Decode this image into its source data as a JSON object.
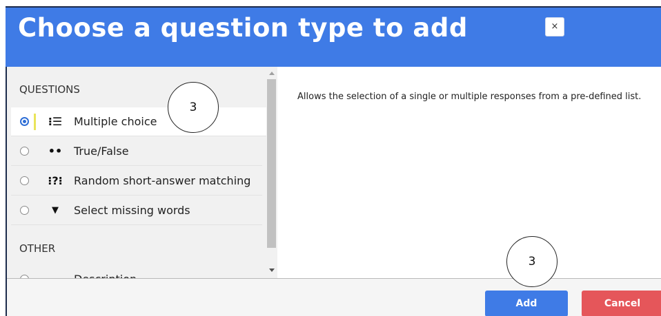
{
  "header": {
    "title": "Choose a question type to add",
    "close_label": "×"
  },
  "sidebar": {
    "questions_heading": "QUESTIONS",
    "items": [
      {
        "label": "Multiple choice",
        "icon": "list-icon",
        "icon_glyph": "⁝☰",
        "selected": true
      },
      {
        "label": "True/False",
        "icon": "two-dots-icon",
        "icon_glyph": "••",
        "selected": false
      },
      {
        "label": "Random short-answer matching",
        "icon": "question-match-icon",
        "icon_glyph": "⁝?⁝",
        "selected": false
      },
      {
        "label": "Select missing words",
        "icon": "caret-down-icon",
        "icon_glyph": "▼",
        "selected": false
      }
    ],
    "other_heading": "OTHER",
    "other_items": [
      {
        "label": "Description",
        "icon": "description-icon",
        "icon_glyph": "▭"
      }
    ]
  },
  "main": {
    "description": "Allows the selection of a single or multiple responses from a pre-defined list."
  },
  "footer": {
    "add_label": "Add",
    "cancel_label": "Cancel"
  },
  "annotations": {
    "marker_1": "3",
    "marker_2": "3"
  },
  "colors": {
    "header": "#3f7be6",
    "add": "#3f7be6",
    "cancel": "#e5565a",
    "selection_bar": "#e9e45a"
  }
}
